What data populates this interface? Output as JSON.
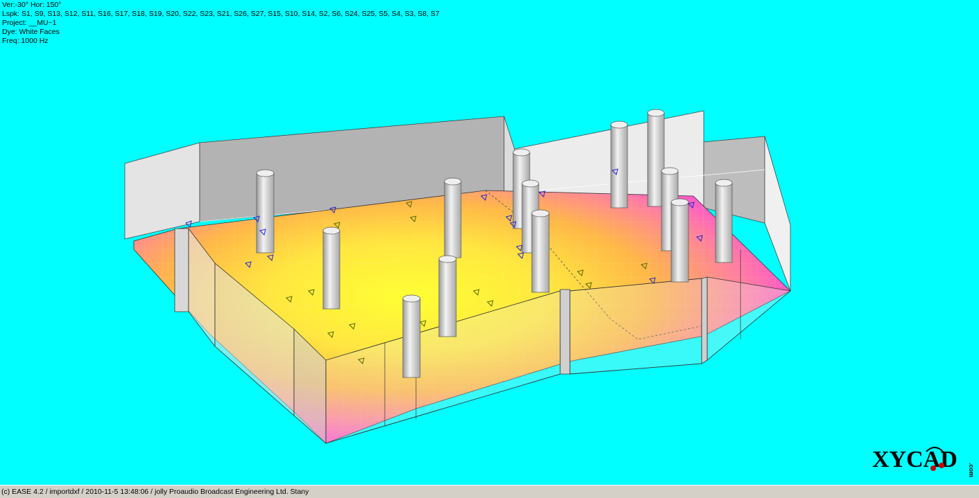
{
  "info": {
    "view": "Ver:-30°   Hor: 150°",
    "loudspeakers": "Lspk: S1, S9, S13, S12, S11, S16, S17, S18, S19, S20, S22, S23, S21, S26, S27, S15, S10, S14, S2, S6, S24, S25, S5, S4, S3, S8, S7",
    "project": "Project: __MU~1",
    "dye": "Dye: White Faces",
    "freq": "Freq: 1000 Hz"
  },
  "status": {
    "text": "(c) EASE 4.2  / importdxf  / 2010-11-5 13:48:06 / jolly Proaudio Broadcast Engineering Ltd. Stany"
  },
  "logo": {
    "text": "XYCAD",
    "suffix": ".com"
  },
  "colors": {
    "background": "#00ffff",
    "hot": "#ffff33",
    "mid": "#ffb040",
    "cool": "#ff44dd",
    "wall": "#cfcfcf",
    "speaker": "#2222cc"
  }
}
